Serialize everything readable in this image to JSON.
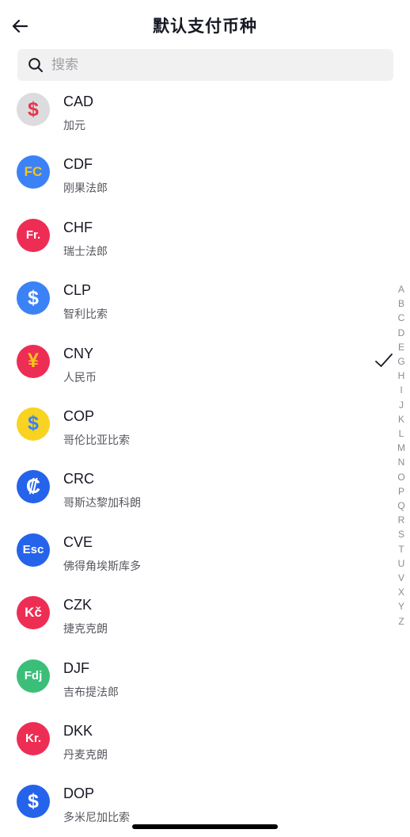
{
  "header": {
    "title": "默认支付币种",
    "back_icon": "arrow-left-icon"
  },
  "search": {
    "placeholder": "搜索",
    "value": "",
    "icon": "search-icon"
  },
  "currencies": [
    {
      "code": "CAD",
      "name": "加元",
      "symbol": "$",
      "badge_bg": "#dcdcdf",
      "badge_fg": "#e8344f",
      "selected": false
    },
    {
      "code": "CDF",
      "name": "刚果法郎",
      "symbol": "FC",
      "badge_bg": "#3b82f6",
      "badge_fg": "#f5c518",
      "selected": false
    },
    {
      "code": "CHF",
      "name": "瑞士法郎",
      "symbol": "Fr.",
      "badge_bg": "#ee2d55",
      "badge_fg": "#ffffff",
      "selected": false
    },
    {
      "code": "CLP",
      "name": "智利比索",
      "symbol": "$",
      "badge_bg": "#3b82f6",
      "badge_fg": "#ffffff",
      "selected": false
    },
    {
      "code": "CNY",
      "name": "人民币",
      "symbol": "¥",
      "badge_bg": "#ee2d55",
      "badge_fg": "#f5c518",
      "selected": true
    },
    {
      "code": "COP",
      "name": "哥伦比亚比索",
      "symbol": "$",
      "badge_bg": "#f9d322",
      "badge_fg": "#3b82f6",
      "selected": false
    },
    {
      "code": "CRC",
      "name": "哥斯达黎加科朗",
      "symbol": "₡",
      "badge_bg": "#2563eb",
      "badge_fg": "#ffffff",
      "selected": false
    },
    {
      "code": "CVE",
      "name": "佛得角埃斯库多",
      "symbol": "Esc",
      "badge_bg": "#2563eb",
      "badge_fg": "#ffffff",
      "selected": false
    },
    {
      "code": "CZK",
      "name": "捷克克朗",
      "symbol": "Kč",
      "badge_bg": "#ee2d55",
      "badge_fg": "#ffffff",
      "selected": false
    },
    {
      "code": "DJF",
      "name": "吉布提法郎",
      "symbol": "Fdj",
      "badge_bg": "#3bbf78",
      "badge_fg": "#ffffff",
      "selected": false
    },
    {
      "code": "DKK",
      "name": "丹麦克朗",
      "symbol": "Kr.",
      "badge_bg": "#ee2d55",
      "badge_fg": "#ffffff",
      "selected": false
    },
    {
      "code": "DOP",
      "name": "多米尼加比索",
      "symbol": "$",
      "badge_bg": "#2563eb",
      "badge_fg": "#ffffff",
      "selected": false
    }
  ],
  "index_letters": [
    "A",
    "B",
    "C",
    "D",
    "E",
    "G",
    "H",
    "I",
    "J",
    "K",
    "L",
    "M",
    "N",
    "O",
    "P",
    "Q",
    "R",
    "S",
    "T",
    "U",
    "V",
    "X",
    "Y",
    "Z"
  ],
  "colors": {
    "accent_check": "#161823",
    "secondary_text": "#57585f",
    "index_text": "#8a8b91"
  }
}
